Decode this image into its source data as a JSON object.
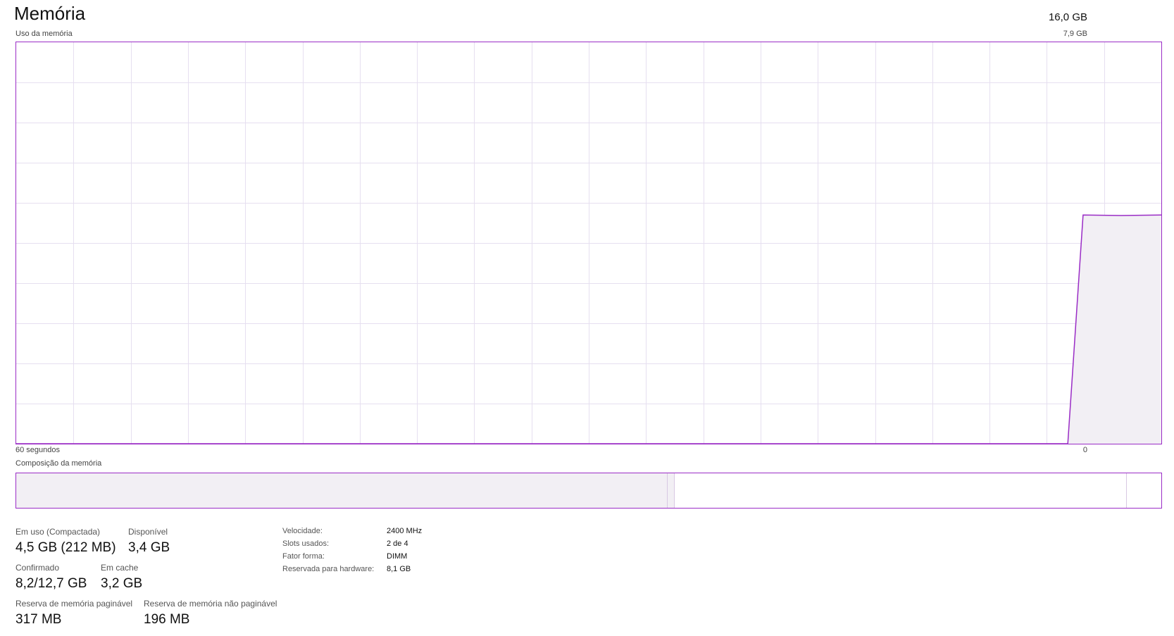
{
  "header": {
    "title": "Memória",
    "total": "16,0 GB"
  },
  "usage_graph": {
    "label": "Uso da memória",
    "max_label": "7,9 GB",
    "time_left": "60 segundos",
    "time_right": "0",
    "line_color": "#9a2cc6",
    "fill_color": "#f2eff4",
    "grid_color": "#e6dff0",
    "max_value_gb": 7.9,
    "samples": [
      {
        "t": 60,
        "gb": 0
      },
      {
        "t": 4.9,
        "gb": 0
      },
      {
        "t": 4.1,
        "gb": 4.5
      },
      {
        "t": 2.1,
        "gb": 4.49
      },
      {
        "t": 0,
        "gb": 4.5
      }
    ]
  },
  "composition": {
    "label": "Composição da memória",
    "in_use_fraction": 0.568,
    "modified_fraction": 0.007,
    "standby_fraction": 0.395,
    "free_fraction": 0.03
  },
  "stats": {
    "in_use": {
      "label": "Em uso (Compactada)",
      "value": "4,5 GB (212 MB)"
    },
    "available": {
      "label": "Disponível",
      "value": "3,4 GB"
    },
    "committed": {
      "label": "Confirmado",
      "value": "8,2/12,7 GB"
    },
    "cached": {
      "label": "Em cache",
      "value": "3,2 GB"
    },
    "paged_pool": {
      "label": "Reserva de memória paginável",
      "value": "317 MB"
    },
    "non_paged_pool": {
      "label": "Reserva de memória não paginável",
      "value": "196 MB"
    }
  },
  "specs": [
    {
      "key": "Velocidade:",
      "value": "2400 MHz"
    },
    {
      "key": "Slots usados:",
      "value": "2 de 4"
    },
    {
      "key": "Fator forma:",
      "value": "DIMM"
    },
    {
      "key": "Reservada para hardware:",
      "value": "8,1 GB"
    }
  ]
}
